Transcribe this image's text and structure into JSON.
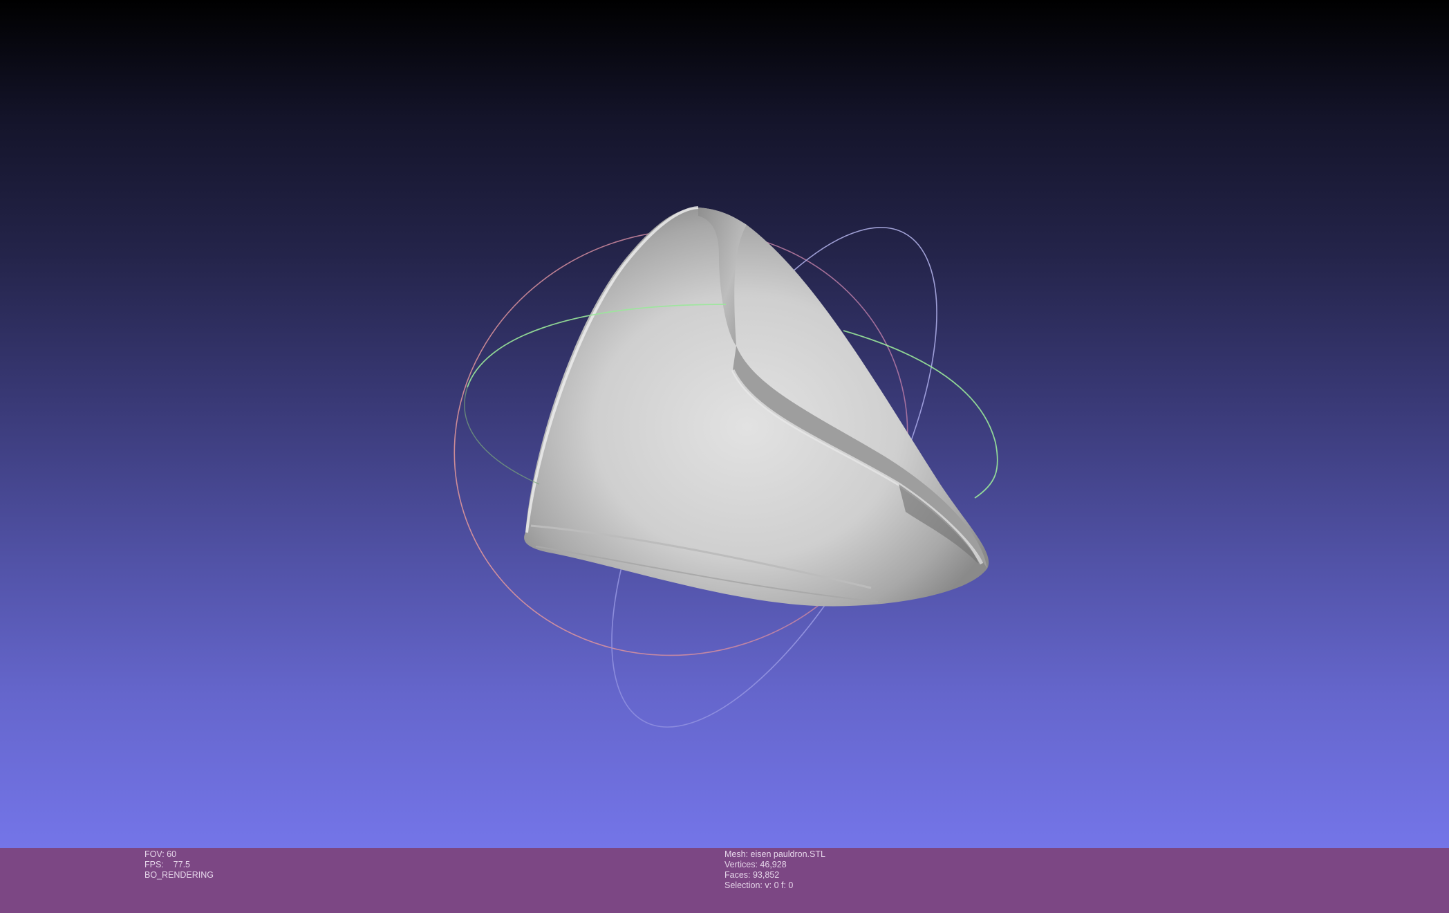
{
  "viewport": {
    "background_top": "#000000",
    "background_bottom": "#7475e8",
    "mesh_color": "#d9d9d9",
    "trackball_colors": {
      "x_ring": "#e88a8a",
      "y_ring": "#8ae88a",
      "z_ring": "#9a9ae8"
    }
  },
  "render_info": {
    "fov": "FOV: 60",
    "fps": "FPS:    77.5",
    "mode": "BO_RENDERING"
  },
  "mesh_info": {
    "mesh": "Mesh: eisen pauldron.STL",
    "vertices": "Vertices: 46,928",
    "faces": "Faces: 93,852",
    "selection": "Selection: v: 0 f: 0"
  }
}
